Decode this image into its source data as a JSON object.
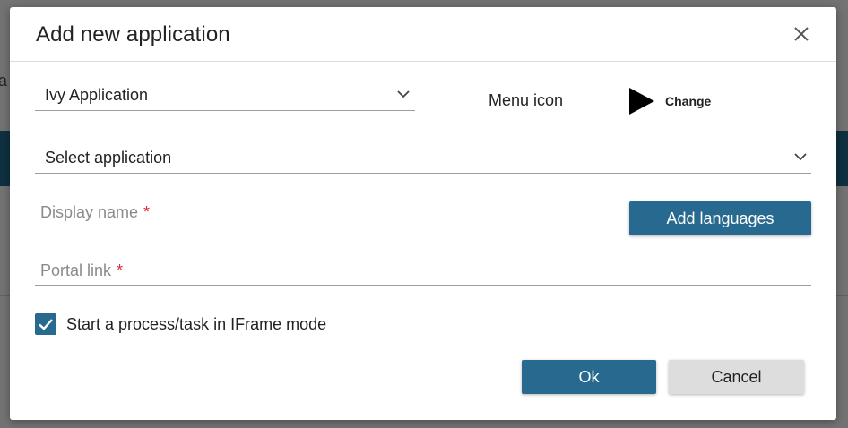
{
  "background": {
    "peek_text": "a"
  },
  "dialog": {
    "title": "Add new application",
    "close_icon": "close-icon",
    "app_type_select": {
      "value": "Ivy Application"
    },
    "menu_icon": {
      "label": "Menu icon",
      "icon": "play-icon",
      "change_label": "Change"
    },
    "application_select": {
      "value": "Select application"
    },
    "display_name": {
      "placeholder": "Display name",
      "required_mark": "*"
    },
    "add_languages_label": "Add languages",
    "portal_link": {
      "placeholder": "Portal link",
      "required_mark": "*"
    },
    "iframe_checkbox": {
      "checked": true,
      "label": "Start a process/task in IFrame mode"
    },
    "ok_label": "Ok",
    "cancel_label": "Cancel"
  },
  "colors": {
    "accent": "#27698f",
    "required": "#d9303a",
    "secondary_button": "#dddddd"
  }
}
